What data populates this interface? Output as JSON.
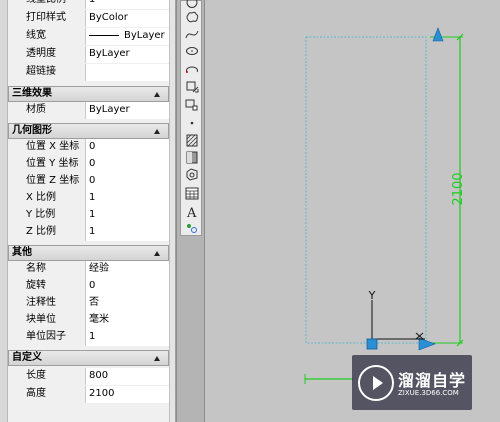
{
  "palette": {
    "general_rows": [
      {
        "key": "线型比例",
        "value": "1"
      },
      {
        "key": "打印样式",
        "value": "ByColor"
      },
      {
        "key": "线宽",
        "value": "ByLayer"
      },
      {
        "key": "透明度",
        "value": "ByLayer"
      },
      {
        "key": "超链接",
        "value": ""
      }
    ],
    "section_3d": {
      "title": "三维效果",
      "rows": [
        {
          "key": "材质",
          "value": "ByLayer"
        }
      ]
    },
    "section_geometry": {
      "title": "几何图形",
      "rows": [
        {
          "key": "位置 X 坐标",
          "value": "0"
        },
        {
          "key": "位置 Y 坐标",
          "value": "0"
        },
        {
          "key": "位置 Z 坐标",
          "value": "0"
        },
        {
          "key": "X 比例",
          "value": "1"
        },
        {
          "key": "Y 比例",
          "value": "1"
        },
        {
          "key": "Z 比例",
          "value": "1"
        }
      ]
    },
    "section_misc": {
      "title": "其他",
      "rows": [
        {
          "key": "名称",
          "value": "经验"
        },
        {
          "key": "旋转",
          "value": "0"
        },
        {
          "key": "注释性",
          "value": "否"
        },
        {
          "key": "块单位",
          "value": "毫米"
        },
        {
          "key": "单位因子",
          "value": "1"
        }
      ]
    },
    "section_custom": {
      "title": "自定义",
      "rows": [
        {
          "key": "长度",
          "value": "800"
        },
        {
          "key": "高度",
          "value": "2100"
        }
      ]
    }
  },
  "toolbar": {
    "tools": [
      "circle-icon",
      "revcloud-icon",
      "spline-icon",
      "ellipse-icon",
      "ellipse-arc-icon",
      "insert-block-icon",
      "make-block-icon",
      "point-icon",
      "hatch-icon",
      "gradient-icon",
      "region-icon",
      "table-icon",
      "mtext-icon",
      "add-selected-icon"
    ]
  },
  "canvas": {
    "dimension_text": "2100",
    "ucs_y_label": "Y",
    "colors": {
      "grip": "#2b8fd6",
      "dimension": "#22cc22",
      "outline": "#5ab8d0",
      "background": "#c5c5c5"
    }
  },
  "watermark": {
    "title": "溜溜自学",
    "url": "ZIXUE.3D66.COM"
  }
}
